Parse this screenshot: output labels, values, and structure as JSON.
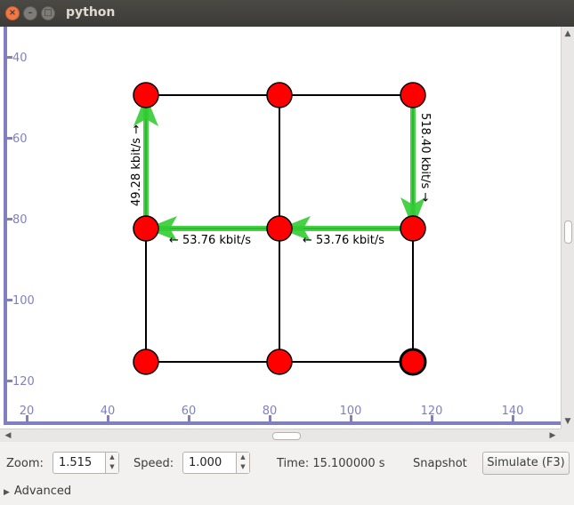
{
  "window": {
    "title": "python",
    "close_glyph": "×",
    "minimize_glyph": "–",
    "maximize_glyph": "□"
  },
  "axes": {
    "y_ticks": [
      "40",
      "60",
      "80",
      "100",
      "120"
    ],
    "x_ticks": [
      "20",
      "40",
      "60",
      "80",
      "100",
      "120",
      "140"
    ],
    "axis_color": "#8080c0"
  },
  "network": {
    "node_color": "#ff0000",
    "flow_color": "#33cc33",
    "nodes": [
      "n1",
      "n2",
      "n3",
      "n4",
      "n5",
      "n6",
      "n7",
      "n8",
      "n9"
    ],
    "flows": [
      {
        "from": "n6",
        "to": "n9",
        "label": "518.40 kbit/s →"
      },
      {
        "from": "n4",
        "to": "n1",
        "label": "49.28 kbit/s →"
      },
      {
        "from": "n5",
        "to": "n4",
        "label": "← 53.76 kbit/s"
      },
      {
        "from": "n6",
        "to": "n5",
        "label": "← 53.76 kbit/s"
      }
    ]
  },
  "controls": {
    "zoom_label": "Zoom:",
    "zoom_value": "1.515",
    "speed_label": "Speed:",
    "speed_value": "1.000",
    "time_text": "Time: 15.100000 s",
    "snapshot_label": "Snapshot",
    "simulate_label": "Simulate (F3)",
    "advanced_label": "Advanced",
    "spin_up": "▲",
    "spin_down": "▼",
    "expander_glyph": "▶"
  },
  "scrollbars": {
    "up": "▲",
    "down": "▼",
    "left": "◀",
    "right": "▶"
  }
}
